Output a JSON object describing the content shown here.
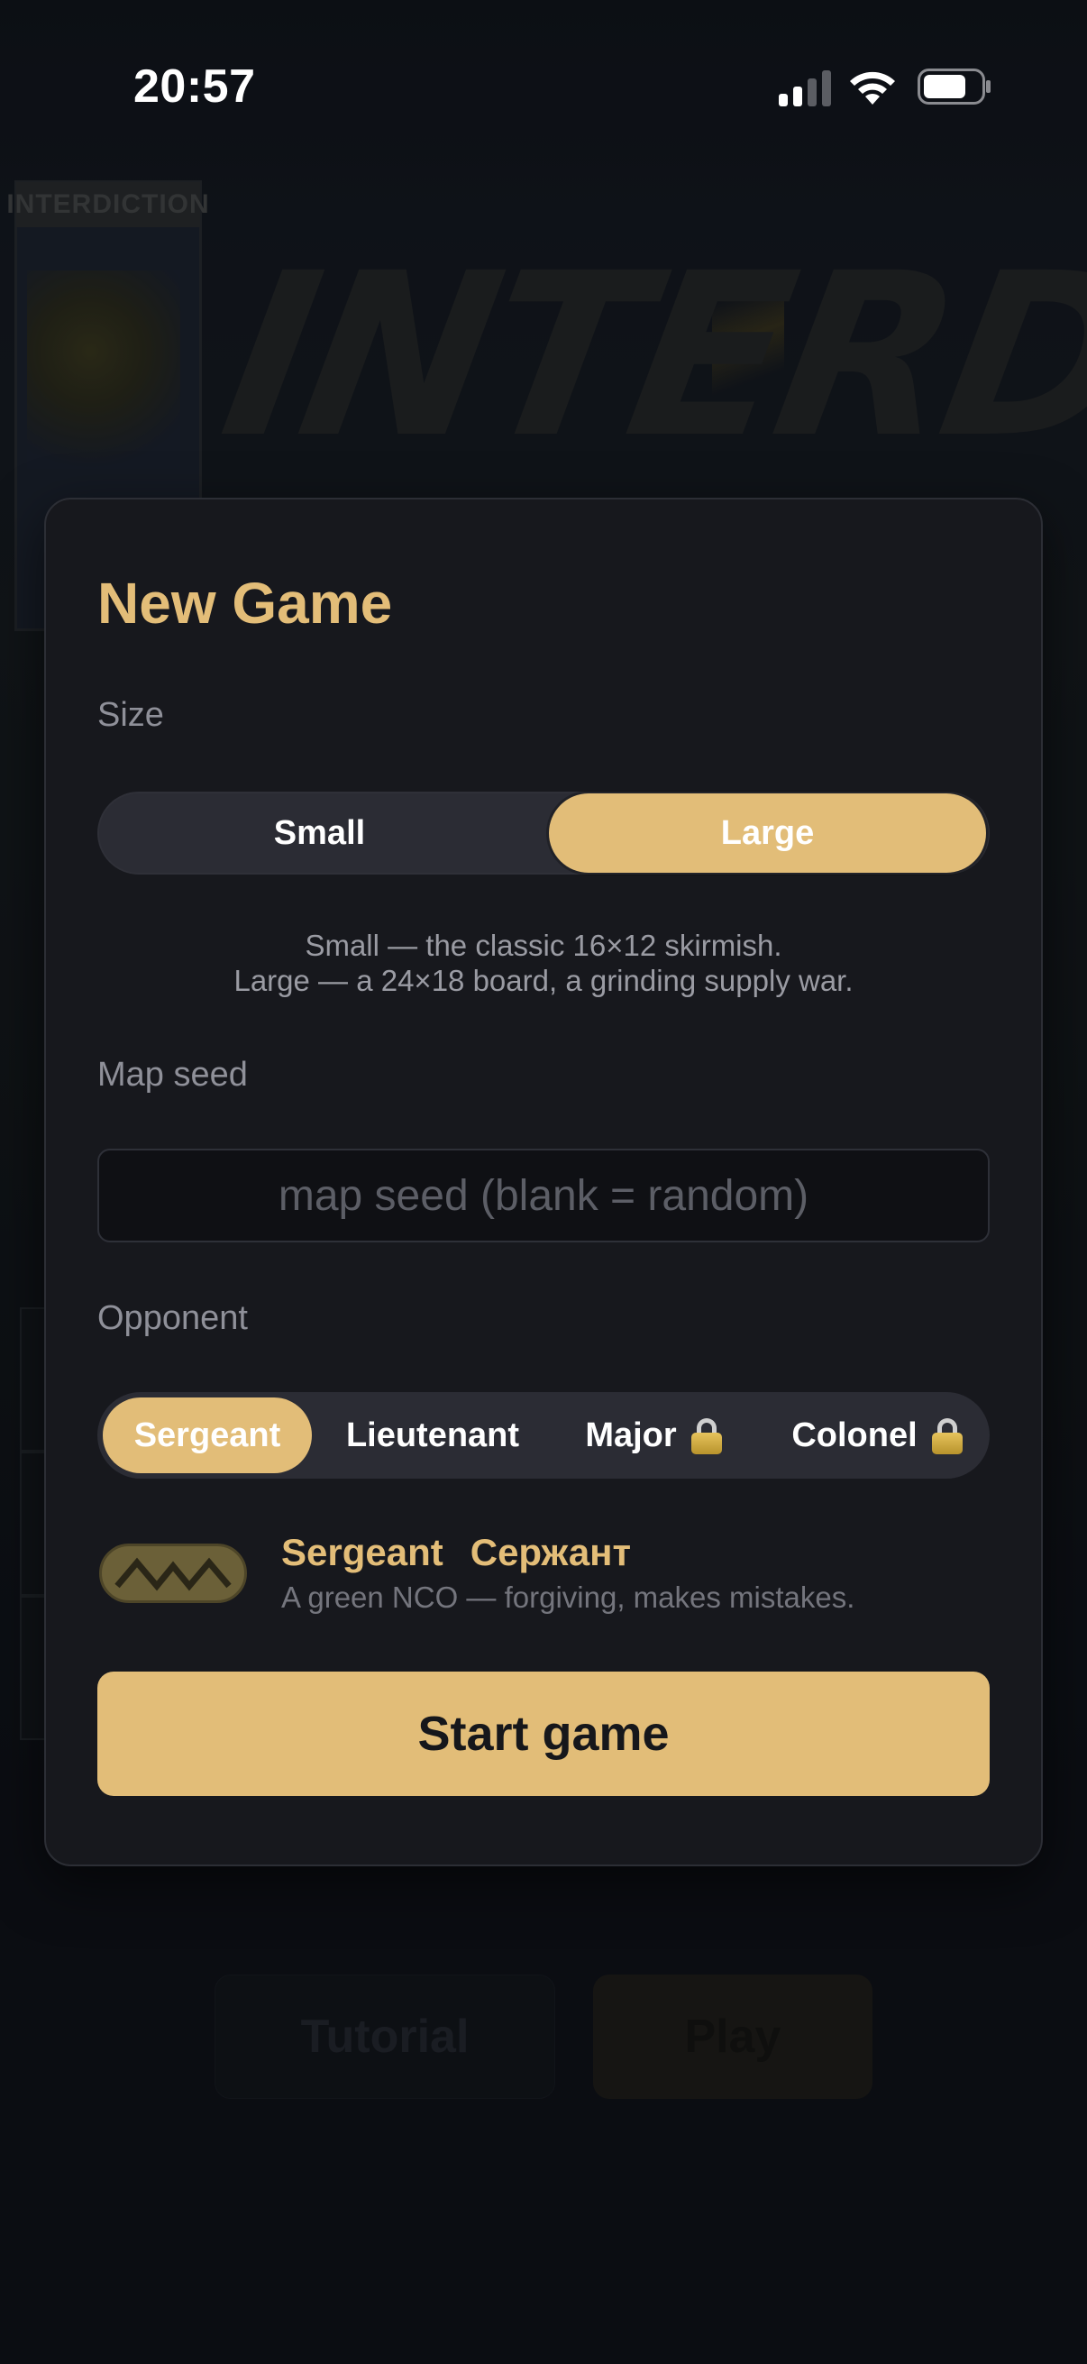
{
  "status_bar": {
    "time": "20:57",
    "signal_icon": "cellular-signal-icon",
    "wifi_icon": "wifi-icon",
    "battery_icon": "battery-icon"
  },
  "background": {
    "card_title": "INTERDICTION",
    "game_title": "INTERDICTION",
    "tutorial_label": "Tutorial",
    "play_label": "Play"
  },
  "modal": {
    "title": "New Game",
    "size": {
      "label": "Size",
      "options": [
        "Small",
        "Large"
      ],
      "selected": "Large",
      "description_lines": [
        "Small — the classic 16×12 skirmish.",
        "Large — a 24×18 board, a grinding supply war."
      ]
    },
    "seed": {
      "label": "Map seed",
      "value": "",
      "placeholder": "map seed (blank = random)"
    },
    "opponent": {
      "label": "Opponent",
      "options": [
        {
          "label": "Sergeant",
          "locked": false
        },
        {
          "label": "Lieutenant",
          "locked": false
        },
        {
          "label": "Major",
          "locked": true
        },
        {
          "label": "Colonel",
          "locked": true
        }
      ],
      "selected": "Sergeant",
      "lock_icon": "lock-icon"
    },
    "rank": {
      "icon": "sergeant-chevron-badge-icon",
      "name": "Sergeant",
      "name_ru": "Сержант",
      "description": "A green NCO — forgiving, makes mistakes."
    },
    "start_label": "Start game"
  },
  "colors": {
    "accent": "#e2bd78",
    "modal_bg": "#17181d",
    "control_bg": "#2b2c34",
    "screen_bg": "#0e1016"
  }
}
